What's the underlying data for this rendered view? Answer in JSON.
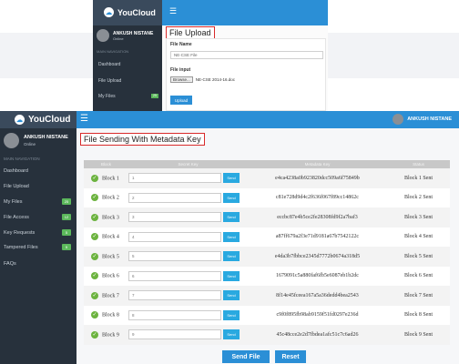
{
  "top_window": {
    "brand": "YouCloud",
    "user": {
      "name": "ANKUSH NISTANE",
      "status": "Online"
    },
    "nav_title": "MAIN NAVIGATION",
    "nav_items": [
      {
        "label": "Dashboard"
      },
      {
        "label": "File Upload"
      },
      {
        "label": "My Files",
        "badge": "25"
      }
    ],
    "page_title": "File Upload",
    "form": {
      "file_name_label": "File Name",
      "file_name_value": "NE-CSE File",
      "file_input_label": "File input",
      "browse_label": "Browse...",
      "file_selected": "NE-CSE 2014-16.doc",
      "upload_label": "Upload"
    }
  },
  "app": {
    "brand": "YouCloud",
    "header_user": "ANKUSH NISTANE",
    "sidebar": {
      "user": {
        "name": "ANKUSH NISTANE",
        "status": "Online"
      },
      "nav_title": "MAIN NAVIGATION",
      "items": [
        {
          "label": "Dashboard"
        },
        {
          "label": "File Upload"
        },
        {
          "label": "My Files",
          "badge": "25"
        },
        {
          "label": "File Access",
          "badge": "12"
        },
        {
          "label": "Key Requests",
          "badge": "5"
        },
        {
          "label": "Tampered Files",
          "badge": "5"
        },
        {
          "label": "FAQs"
        }
      ]
    },
    "page_title": "File Sending With Metadata Key",
    "table": {
      "headers": [
        "Block",
        "Secret Key",
        "Metadata Key",
        "Status"
      ],
      "send_label": "Send",
      "rows": [
        {
          "block": "Block 1",
          "key": "1",
          "meta": "e4ca4238a0b923820dcc509a6f75849b",
          "status": "Block 1 Sent"
        },
        {
          "block": "Block 2",
          "key": "2",
          "meta": "c81e728d9d4c2f636f067f89cc14862c",
          "status": "Block 2 Sent"
        },
        {
          "block": "Block 3",
          "key": "3",
          "meta": "eccbc87e4b5ce2fe28308fd9f2a7baf3",
          "status": "Block 3 Sent"
        },
        {
          "block": "Block 4",
          "key": "4",
          "meta": "a87ff679a2f3e71d9181a67b7542122c",
          "status": "Block 4 Sent"
        },
        {
          "block": "Block 5",
          "key": "5",
          "meta": "e4da3b7fbbce2345d7772b0674a318d5",
          "status": "Block 5 Sent"
        },
        {
          "block": "Block 6",
          "key": "6",
          "meta": "1679091c5a880faf6fb5e6087eb1b2dc",
          "status": "Block 6 Sent"
        },
        {
          "block": "Block 7",
          "key": "7",
          "meta": "8f14e45fceea167a5a36dedd4bea2543",
          "status": "Block 7 Sent"
        },
        {
          "block": "Block 8",
          "key": "8",
          "meta": "c9f0f895fb98ab9159f51fd0297e236d",
          "status": "Block 8 Sent"
        },
        {
          "block": "Block 9",
          "key": "9",
          "meta": "45c48cce2e2d7fbdea1afc51c7c6ad26",
          "status": "Block 9 Sent"
        }
      ]
    },
    "send_file_label": "Send File",
    "reset_label": "Reset"
  }
}
